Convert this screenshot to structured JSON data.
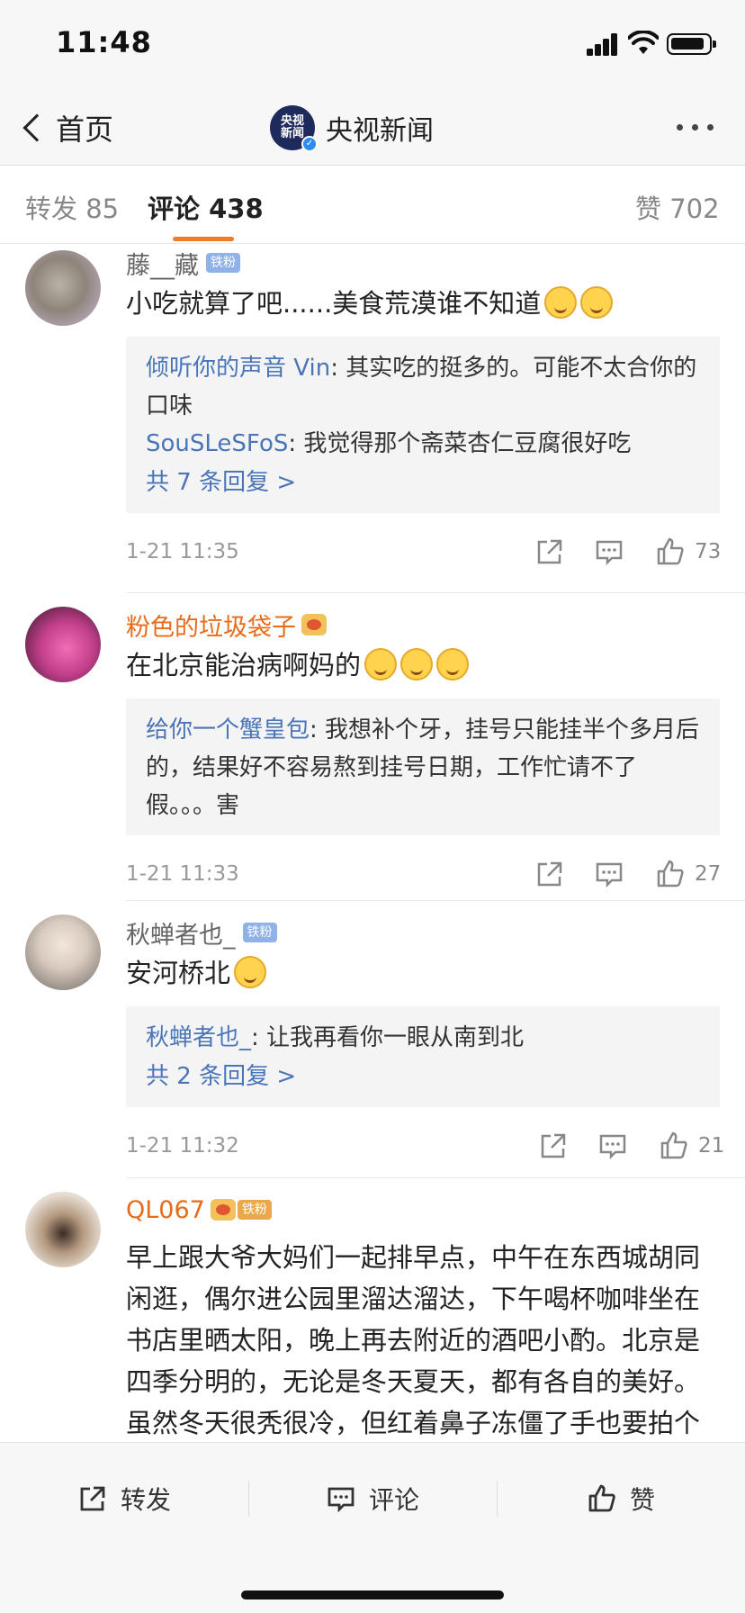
{
  "status_bar": {
    "time": "11:48"
  },
  "nav": {
    "back_label": "首页",
    "account_name": "央视新闻",
    "logo_text_1": "央视",
    "logo_text_2": "新闻"
  },
  "tabs": {
    "repost_label": "转发 85",
    "comment_label": "评论 438",
    "like_label": "赞 702"
  },
  "comments": [
    {
      "user": "藤__藏",
      "badge": "铁粉",
      "text": "小吃就算了吧......美食荒漠谁不知道",
      "emoji_count": 2,
      "replies": [
        {
          "name": "倾听你的声音 Vin",
          "text": ": 其实吃的挺多的。可能不太合你的口味"
        },
        {
          "name": "SouSLeSFoS",
          "text": ": 我觉得那个斋菜杏仁豆腐很好吃"
        }
      ],
      "more_replies": "共 7 条回复 >",
      "time": "1-21 11:35",
      "likes": "73"
    },
    {
      "user": "粉色的垃圾袋子",
      "text": "在北京能治病啊妈的",
      "emoji_count": 3,
      "replies": [
        {
          "name": "给你一个蟹皇包",
          "text": ": 我想补个牙，挂号只能挂半个多月后的，结果好不容易熬到挂号日期，工作忙请不了假。。。害"
        }
      ],
      "time": "1-21 11:33",
      "likes": "27"
    },
    {
      "user": "秋蝉者也_",
      "badge": "铁粉",
      "text": "安河桥北",
      "emoji_count": 1,
      "replies": [
        {
          "name": "秋蝉者也_",
          "text": ": 让我再看你一眼从南到北"
        }
      ],
      "more_replies": "共 2 条回复 >",
      "time": "1-21 11:32",
      "likes": "21"
    },
    {
      "user": "QL067",
      "badge": "铁粉",
      "text": "早上跟大爷大妈们一起排早点，中午在东西城胡同闲逛，偶尔进公园里溜达溜达，下午喝杯咖啡坐在书店里晒太阳，晚上再去附近的酒吧小酌。北京是四季分明的，无论是冬天夏天，都有各自的美好。虽然冬天很秃很冷，但红着鼻子冻僵了手也要拍个照买个糖葫芦吃的感觉可真好。是我"
    }
  ],
  "bottom_bar": {
    "repost": "转发",
    "comment": "评论",
    "like": "赞"
  },
  "colors": {
    "accent": "#f07c26",
    "link": "#4a75b8",
    "orange_name": "#e86b1a"
  }
}
